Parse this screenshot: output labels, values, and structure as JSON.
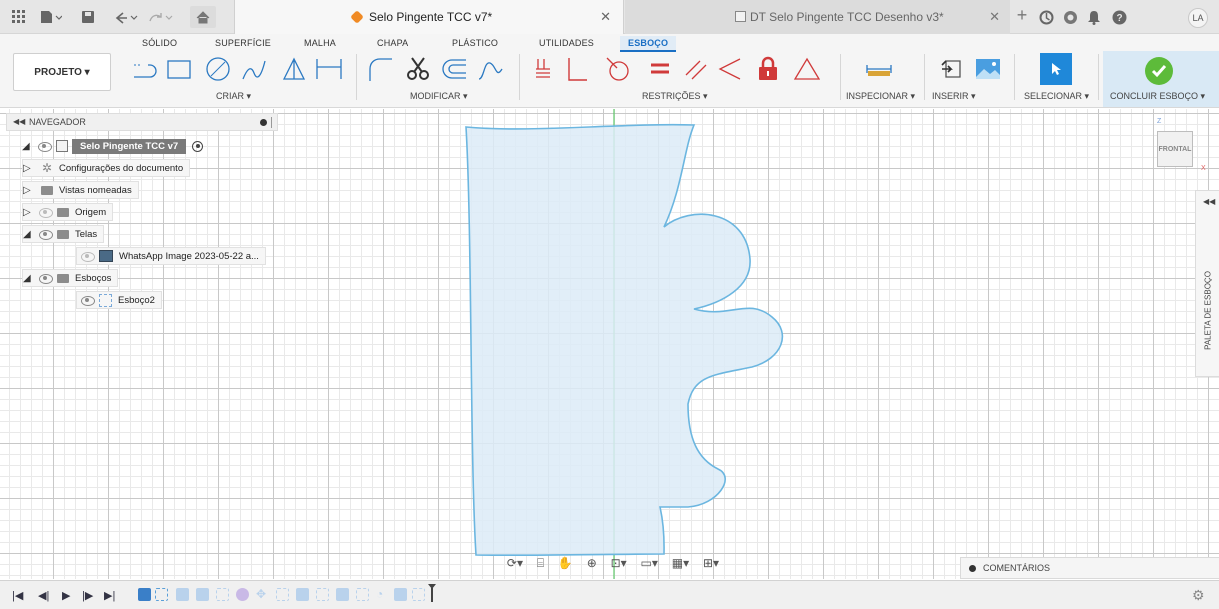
{
  "titlebar": {
    "tab_active": "Selo Pingente TCC v7*",
    "tab_inactive": "DT Selo Pingente TCC Desenho v3*",
    "user_initials": "LA"
  },
  "ribbon": {
    "tabs": [
      "SÓLIDO",
      "SUPERFÍCIE",
      "MALHA",
      "CHAPA",
      "PLÁSTICO",
      "UTILIDADES",
      "ESBOÇO"
    ],
    "active_tab": "ESBOÇO",
    "project_label": "PROJETO ▾",
    "groups": {
      "criar": "CRIAR ▾",
      "modificar": "MODIFICAR ▾",
      "restricoes": "RESTRIÇÕES ▾",
      "inspecionar": "INSPECIONAR ▾",
      "inserir": "INSERIR ▾",
      "selecionar": "SELECIONAR ▾",
      "concluir": "CONCLUIR ESBOÇO ▾"
    },
    "accent_color": "#1f88d9",
    "finish_color": "#5dbb3a"
  },
  "browser": {
    "title": "NAVEGADOR",
    "items": [
      {
        "label": "Selo Pingente TCC v7",
        "kind": "root"
      },
      {
        "label": "Configurações do documento",
        "kind": "settings"
      },
      {
        "label": "Vistas nomeadas",
        "kind": "folder"
      },
      {
        "label": "Origem",
        "kind": "folder"
      },
      {
        "label": "Telas",
        "kind": "folder"
      },
      {
        "label": "WhatsApp Image 2023-05-22 a...",
        "kind": "image"
      },
      {
        "label": "Esboços",
        "kind": "folder"
      },
      {
        "label": "Esboço2",
        "kind": "sketch"
      }
    ]
  },
  "viewcube": {
    "face": "FRONTAL",
    "axis_z": "Z",
    "axis_x": "X"
  },
  "palette_label": "PALETA DE ESBOÇO",
  "comments_label": "COMENTÁRIOS",
  "sketch_fill": "#dcebf7",
  "sketch_stroke": "#6bb6e0"
}
